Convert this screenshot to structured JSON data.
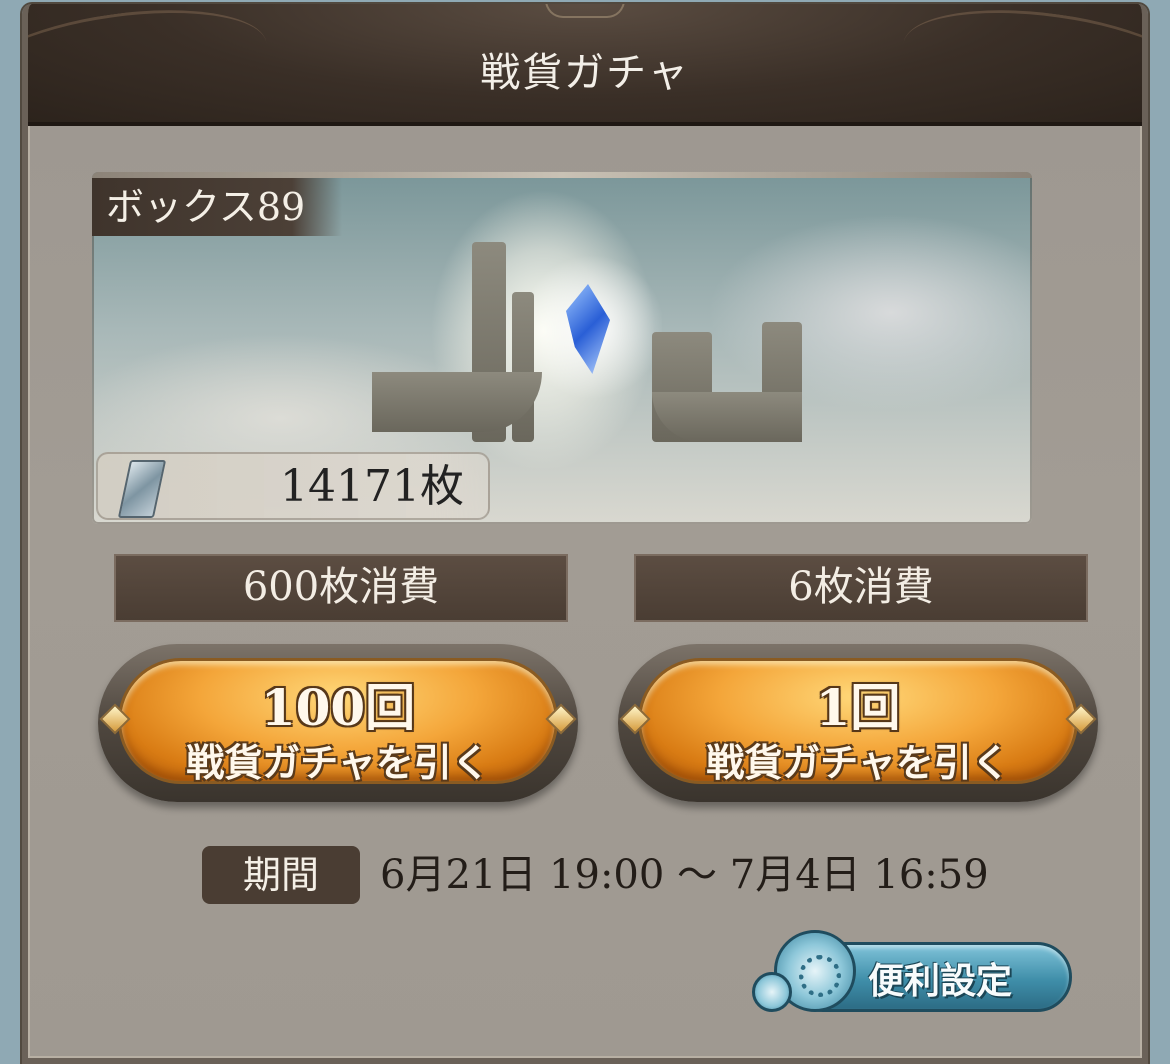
{
  "header": {
    "title": "戦貨ガチャ"
  },
  "banner": {
    "box_label": "ボックス89",
    "currency_count": "14171枚"
  },
  "draw_options": [
    {
      "cost_label": "600枚消費",
      "button_line1": "100回",
      "button_line2": "戦貨ガチャを引く"
    },
    {
      "cost_label": "6枚消費",
      "button_line1": "1回",
      "button_line2": "戦貨ガチャを引く"
    }
  ],
  "period": {
    "label": "期間",
    "value": "6月21日 19:00 〜 7月4日 16:59"
  },
  "settings_button": {
    "label": "便利設定"
  },
  "icons": [
    "ticket-icon",
    "gear-icon",
    "diamond-ornament-icon"
  ],
  "colors": {
    "header_bg": "#3a2f27",
    "panel_bg": "#a29c94",
    "gold_button": "#f4a63a",
    "settings_button": "#3f8ea9"
  }
}
